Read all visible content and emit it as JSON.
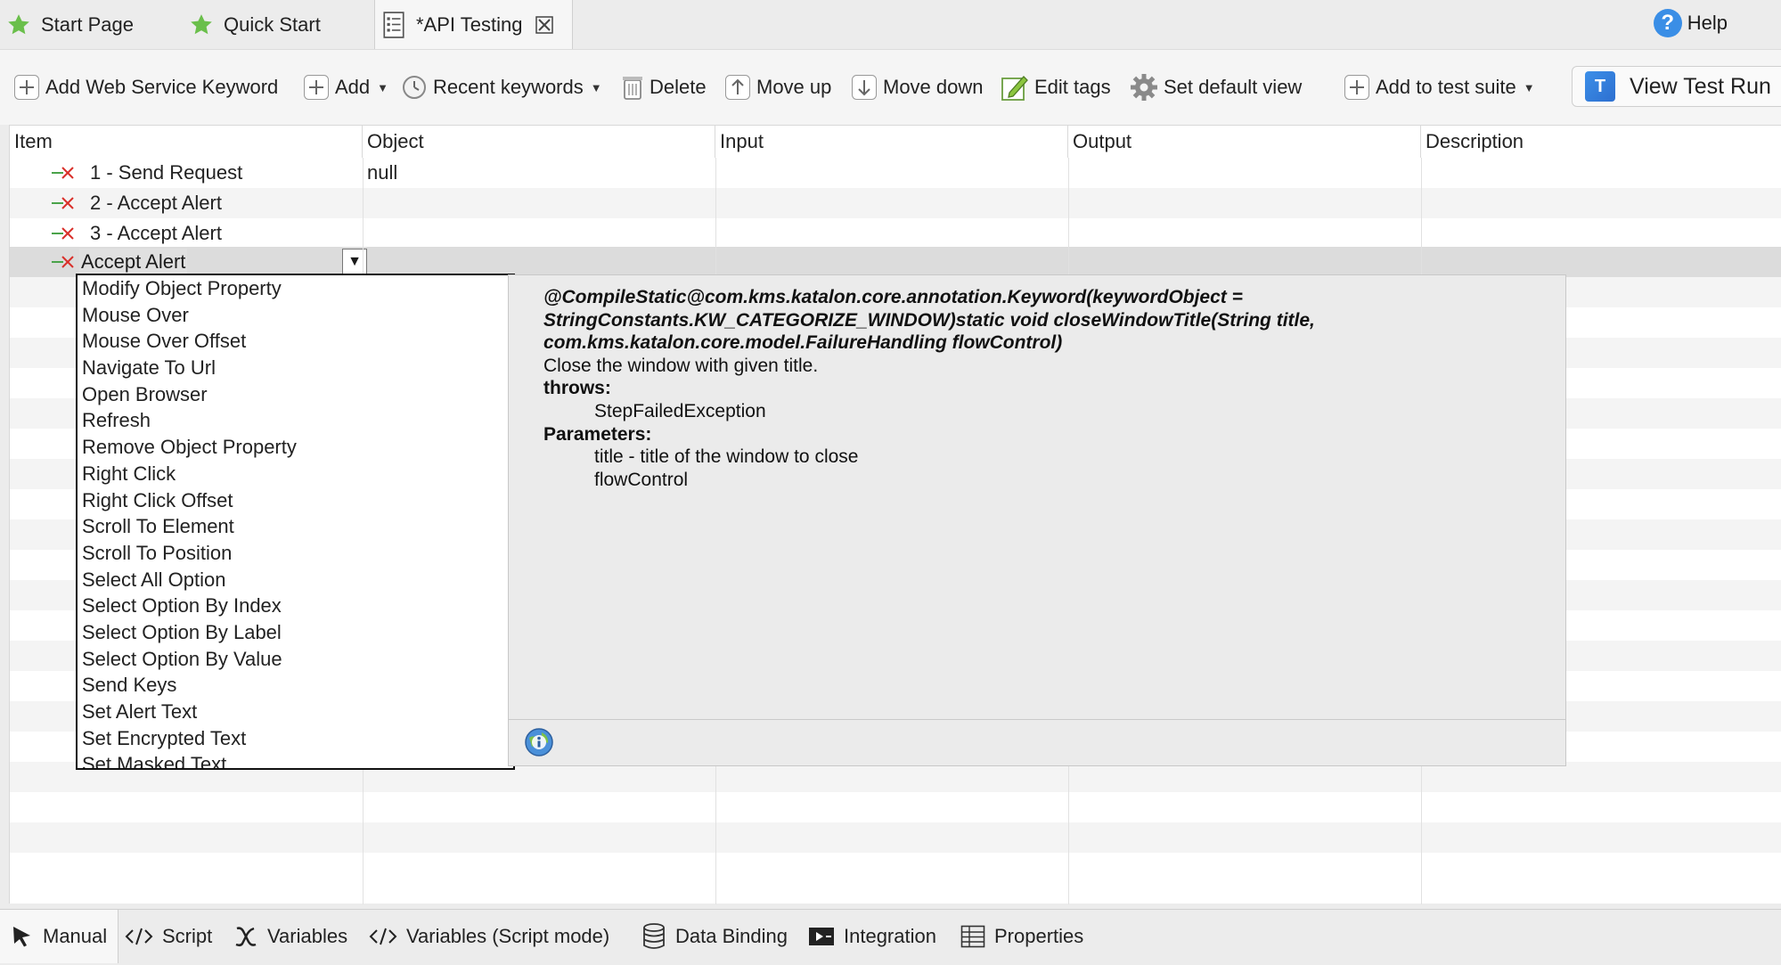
{
  "editor_tabs": [
    {
      "label": "Start Page",
      "icon": "star-icon"
    },
    {
      "label": "Quick Start",
      "icon": "star-icon"
    },
    {
      "label": "*API Testing",
      "icon": "test-case-icon",
      "active": true
    }
  ],
  "help": {
    "label": "Help"
  },
  "toolbar": {
    "add_web_service_keyword": "Add Web Service Keyword",
    "add": "Add",
    "recent_keywords": "Recent keywords",
    "delete": "Delete",
    "move_up": "Move up",
    "move_down": "Move down",
    "edit_tags": "Edit tags",
    "set_default_view": "Set default view",
    "add_to_test_suite": "Add to test suite",
    "view_test_run": "View Test Run"
  },
  "table": {
    "columns": [
      "Item",
      "Object",
      "Input",
      "Output",
      "Description"
    ],
    "rows": [
      {
        "item": "1 - Send Request",
        "object": "null"
      },
      {
        "item": "2 - Accept Alert",
        "object": ""
      },
      {
        "item": "3 - Accept Alert",
        "object": ""
      }
    ],
    "editing_row": {
      "value": "Accept Alert",
      "combo_arrow": "▼"
    }
  },
  "dropdown": {
    "items": [
      "Modify Object Property",
      "Mouse Over",
      "Mouse Over Offset",
      "Navigate To Url",
      "Open Browser",
      "Refresh",
      "Remove Object Property",
      "Right Click",
      "Right Click Offset",
      "Scroll To Element",
      "Scroll To Position",
      "Select All Option",
      "Select Option By Index",
      "Select Option By Label",
      "Select Option By Value",
      "Send Keys",
      "Set Alert Text",
      "Set Encrypted Text",
      "Set Masked Text"
    ]
  },
  "doc": {
    "sig1": "@CompileStatic@com.kms.katalon.core.annotation.Keyword(keywordObject =",
    "sig2": "StringConstants.KW_CATEGORIZE_WINDOW)static void closeWindowTitle(String title,",
    "sig3": "com.kms.katalon.core.model.FailureHandling flowControl)",
    "description": "Close the window with given title.",
    "throws_label": "throws:",
    "throws_value": "StepFailedException",
    "params_label": "Parameters:",
    "param1": "title - title of the window to close",
    "param2": "flowControl"
  },
  "bottom_tabs": [
    {
      "label": "Manual",
      "icon": "cursor-icon",
      "active": true
    },
    {
      "label": "Script",
      "icon": "code-icon"
    },
    {
      "label": "Variables",
      "icon": "variable-x-icon"
    },
    {
      "label": "Variables (Script mode)",
      "icon": "code-icon"
    },
    {
      "label": "Data Binding",
      "icon": "database-icon"
    },
    {
      "label": "Integration",
      "icon": "integration-icon"
    },
    {
      "label": "Properties",
      "icon": "table-icon"
    }
  ],
  "colors": {
    "accent_blue": "#3a8ee6",
    "star_green": "#6abf4b",
    "step_red": "#d9302a",
    "step_green": "#4aa34a"
  }
}
